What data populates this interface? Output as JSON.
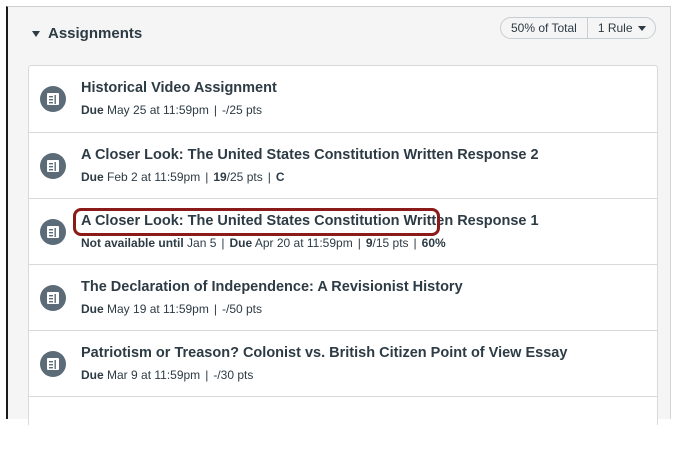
{
  "group": {
    "title": "Assignments",
    "weight": "50% of Total",
    "rules": "1 Rule"
  },
  "assignments": [
    {
      "title": "Historical Video Assignment",
      "due_label": "Due",
      "due_value": "May 25 at 11:59pm",
      "score": "-/25 pts"
    },
    {
      "title": "A Closer Look: The United States Constitution Written Response 2",
      "due_label": "Due",
      "due_value": "Feb 2 at 11:59pm",
      "score_earned": "19",
      "score_total": "/25 pts",
      "grade": "C"
    },
    {
      "title": "A Closer Look: The United States Constitution Written Response 1",
      "availability_label": "Not available until",
      "availability_value": "Jan 5",
      "due_label": "Due",
      "due_value": "Apr 20 at 11:59pm",
      "score_earned": "9",
      "score_total": "/15 pts",
      "grade": "60%"
    },
    {
      "title": "The Declaration of Independence: A Revisionist History",
      "due_label": "Due",
      "due_value": "May 19 at 11:59pm",
      "score": "-/50 pts"
    },
    {
      "title": "Patriotism or Treason? Colonist vs. British Citizen Point of View Essay",
      "due_label": "Due",
      "due_value": "Mar 9 at 11:59pm",
      "score": "-/30 pts"
    }
  ],
  "colors": {
    "text": "#2d3b45",
    "icon_bg": "#5b6b78",
    "highlight": "#8b1a1a",
    "group_bg": "#f5f5f5"
  },
  "icons": {
    "collapse": "caret-down-icon",
    "assignment": "assignment-icon"
  }
}
